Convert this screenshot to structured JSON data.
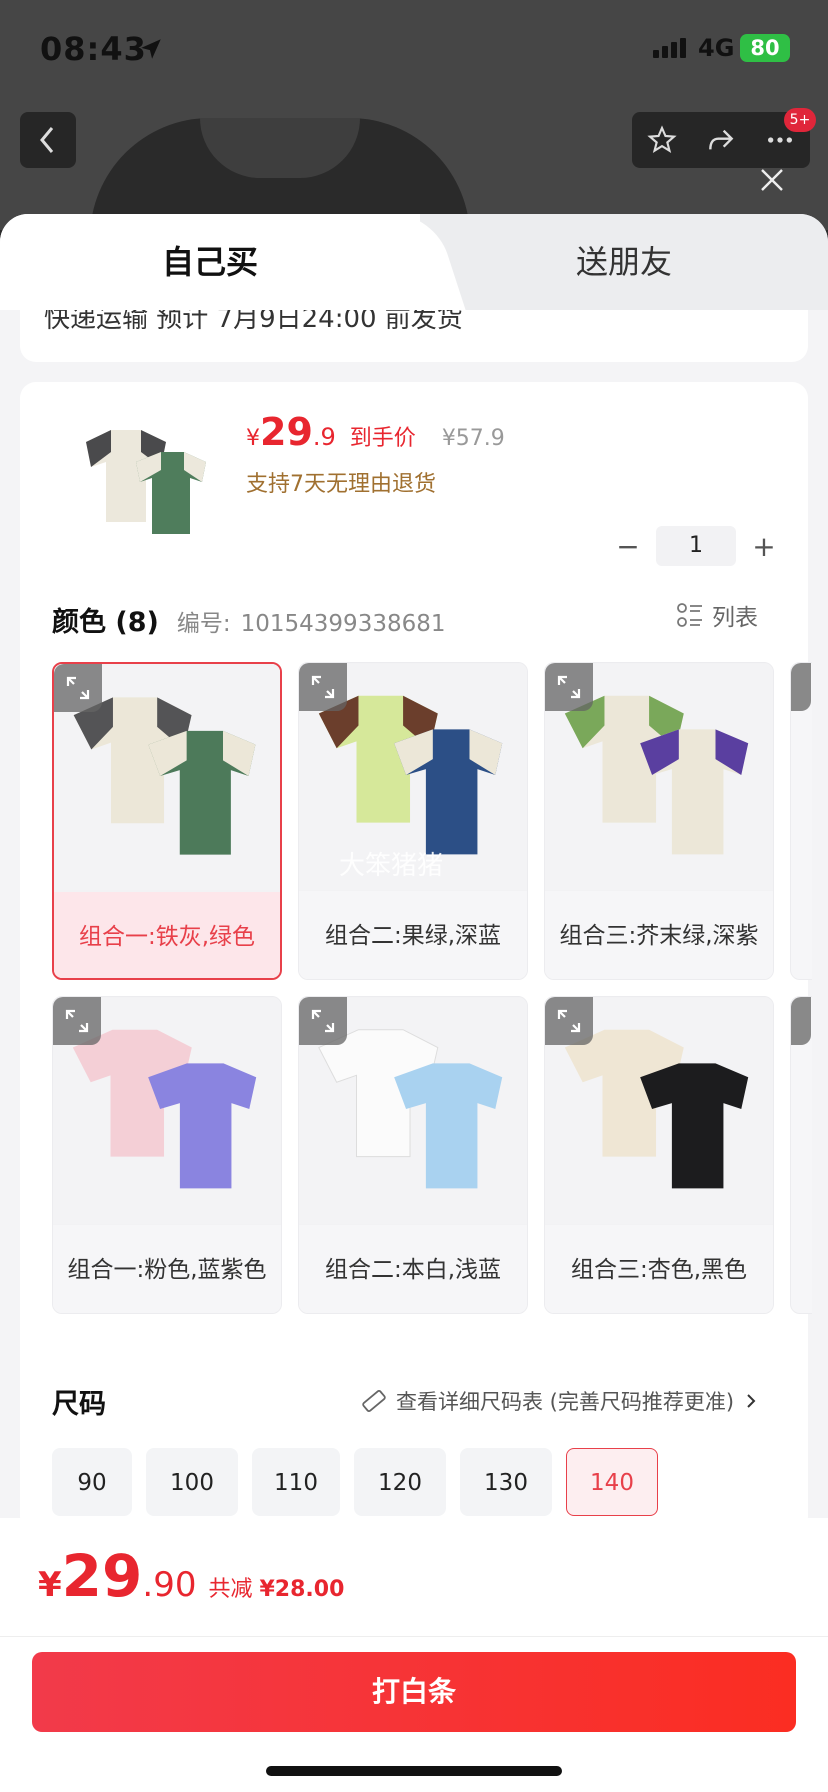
{
  "status_bar": {
    "time": "08:43",
    "network": "4G",
    "battery": "80"
  },
  "nav": {
    "badge": "5+"
  },
  "tabs": [
    {
      "label": "自己买"
    },
    {
      "label": "送朋友"
    }
  ],
  "shipping_note": "快递运输 预计 7月9日24:00 前发货",
  "product": {
    "price_symbol": "¥",
    "price_int": "29",
    "price_dec": ".9",
    "price_label": "到手价",
    "original_price": "¥57.9",
    "return_note": "支持7天无理由退货",
    "quantity": "1"
  },
  "color": {
    "title": "颜色 (8)",
    "sku_label": "编号:",
    "sku_value": "10154399338681",
    "list_label": "列表",
    "options": [
      {
        "label": "组合一:铁灰,绿色",
        "selected": true
      },
      {
        "label": "组合二:果绿,深蓝",
        "selected": false,
        "watermark": "大笨猪猪"
      },
      {
        "label": "组合三:芥末绿,深紫",
        "selected": false
      },
      {
        "label": "组合一:粉色,蓝紫色",
        "selected": false
      },
      {
        "label": "组合二:本白,浅蓝",
        "selected": false
      },
      {
        "label": "组合三:杏色,黑色",
        "selected": false
      }
    ]
  },
  "size": {
    "title": "尺码",
    "chart_link": "查看详细尺码表 (完善尺码推荐更准)",
    "options": [
      {
        "label": "90",
        "selected": false
      },
      {
        "label": "100",
        "selected": false
      },
      {
        "label": "110",
        "selected": false
      },
      {
        "label": "120",
        "selected": false
      },
      {
        "label": "130",
        "selected": false
      },
      {
        "label": "140",
        "selected": true
      }
    ]
  },
  "footer": {
    "price_symbol": "¥",
    "price_int": "29",
    "price_dec": ".90",
    "savings_prefix": "共减",
    "savings": "¥28.00",
    "cta": "打白条"
  },
  "colors": {
    "accent": "#e8262f",
    "selected_bg": "#fde6ea"
  }
}
